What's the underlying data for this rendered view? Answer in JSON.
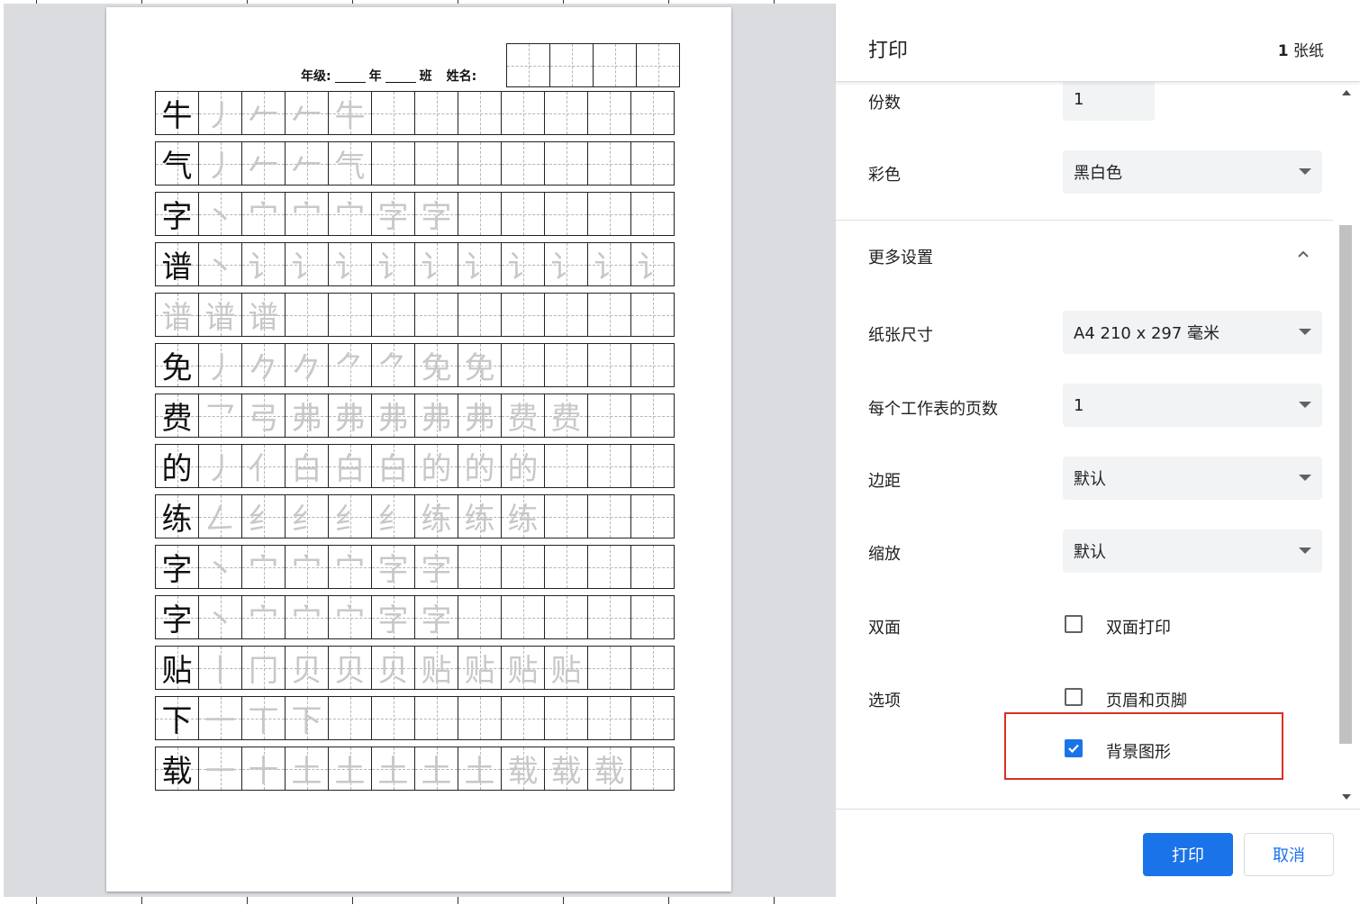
{
  "preview": {
    "worksheet": {
      "grade_label": "年级:",
      "year_label": "年",
      "class_label": "班",
      "name_label": "姓名:",
      "rows": [
        {
          "model": "牛",
          "traces": [
            "丿",
            "𠂉",
            "𠂉",
            "牛"
          ]
        },
        {
          "model": "气",
          "traces": [
            "丿",
            "𠂉",
            "𠂉",
            "气"
          ]
        },
        {
          "model": "字",
          "traces": [
            "丶",
            "宀",
            "宀",
            "宀",
            "字",
            "字"
          ]
        },
        {
          "model": "谱",
          "traces": [
            "丶",
            "讠",
            "讠",
            "讠",
            "讠",
            "讠",
            "讠",
            "讠",
            "讠",
            "讠",
            "讠"
          ]
        },
        {
          "model": "",
          "traces": [
            "谱",
            "谱",
            "谱"
          ]
        },
        {
          "model": "免",
          "traces": [
            "丿",
            "𠂊",
            "𠂊",
            "⺈",
            "⺈",
            "免",
            "免"
          ]
        },
        {
          "model": "费",
          "traces": [
            "乛",
            "弓",
            "弗",
            "弗",
            "弗",
            "弗",
            "弗",
            "费",
            "费"
          ]
        },
        {
          "model": "的",
          "traces": [
            "丿",
            "亻",
            "白",
            "白",
            "白",
            "的",
            "的",
            "的"
          ]
        },
        {
          "model": "练",
          "traces": [
            "𠃋",
            "纟",
            "纟",
            "纟",
            "纟",
            "练",
            "练",
            "练"
          ]
        },
        {
          "model": "字",
          "traces": [
            "丶",
            "宀",
            "宀",
            "宀",
            "字",
            "字"
          ]
        },
        {
          "model": "字",
          "traces": [
            "丶",
            "宀",
            "宀",
            "宀",
            "字",
            "字"
          ]
        },
        {
          "model": "贴",
          "traces": [
            "丨",
            "冂",
            "贝",
            "贝",
            "贝",
            "贴",
            "贴",
            "贴",
            "贴"
          ]
        },
        {
          "model": "下",
          "traces": [
            "一",
            "丅",
            "下"
          ]
        },
        {
          "model": "载",
          "traces": [
            "一",
            "十",
            "土",
            "土",
            "土",
            "土",
            "土",
            "载",
            "载",
            "载"
          ]
        }
      ]
    }
  },
  "panel": {
    "title": "打印",
    "sheet_count_number": "1",
    "sheet_count_unit": "张纸",
    "copies_label": "份数",
    "copies_value": "1",
    "color_label": "彩色",
    "color_value": "黑白色",
    "more_settings_label": "更多设置",
    "paper_size_label": "纸张尺寸",
    "paper_size_value": "A4 210 x 297 毫米",
    "pages_per_sheet_label": "每个工作表的页数",
    "pages_per_sheet_value": "1",
    "margins_label": "边距",
    "margins_value": "默认",
    "scale_label": "缩放",
    "scale_value": "默认",
    "duplex_label": "双面",
    "duplex_option": "双面打印",
    "duplex_checked": false,
    "options_label": "选项",
    "headers_footers_option": "页眉和页脚",
    "headers_footers_checked": false,
    "background_graphics_option": "背景图形",
    "background_graphics_checked": true,
    "print_button": "打印",
    "cancel_button": "取消"
  },
  "colors": {
    "accent": "#1a73e8",
    "highlight": "#d93025",
    "preview_bg": "#dadce0",
    "field_bg": "#f1f3f4"
  }
}
